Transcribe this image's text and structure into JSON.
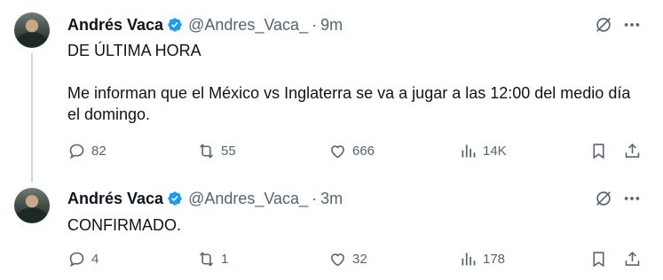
{
  "colors": {
    "text": "#0f1419",
    "muted": "#536471",
    "verified": "#1d9bf0",
    "line": "#cfd9de"
  },
  "tweets": [
    {
      "author": {
        "name": "Andrés Vaca",
        "handle": "@Andres_Vaca_",
        "verified": true
      },
      "separator": "·",
      "time": "9m",
      "text_line1": "DE ÚLTIMA HORA",
      "text_line2": "Me informan que el México vs Inglaterra se va a jugar a las 12:00 del medio día el domingo.",
      "stats": {
        "replies": "82",
        "reposts": "55",
        "likes": "666",
        "views": "14K"
      }
    },
    {
      "author": {
        "name": "Andrés Vaca",
        "handle": "@Andres_Vaca_",
        "verified": true
      },
      "separator": "·",
      "time": "3m",
      "text_line1": "CONFIRMADO.",
      "stats": {
        "replies": "4",
        "reposts": "1",
        "likes": "32",
        "views": "178"
      }
    }
  ]
}
